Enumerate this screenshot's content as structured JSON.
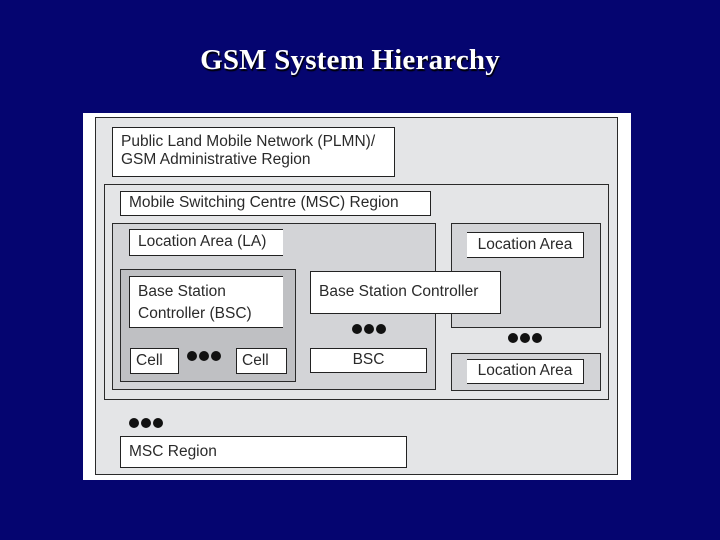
{
  "slide": {
    "title": "GSM System Hierarchy",
    "background_color": "#050570"
  },
  "diagram": {
    "plmn_label": "Public Land Mobile Network (PLMN)/ GSM Administrative Region",
    "msc_region_label": "Mobile Switching Centre (MSC) Region",
    "location_area_label": "Location Area (LA)",
    "bsc_label": "Base Station Controller (BSC)",
    "cell_left_label": "Cell",
    "cell_right_label": "Cell",
    "bsc2_label": "Base Station Controller",
    "bsc_short_label": "BSC",
    "location_area_right_top_label": "Location Area",
    "location_area_right_bottom_label": "Location Area",
    "msc_region_bottom_label": "MSC Region",
    "ellipsis_icon": "ellipsis-dots",
    "colors": {
      "frame": "#ffffff",
      "outer_panel": "#e4e5e7",
      "la_panel": "#d3d4d7",
      "bsc_panel": "#bfc0c3",
      "border": "#2a2a2a"
    }
  }
}
